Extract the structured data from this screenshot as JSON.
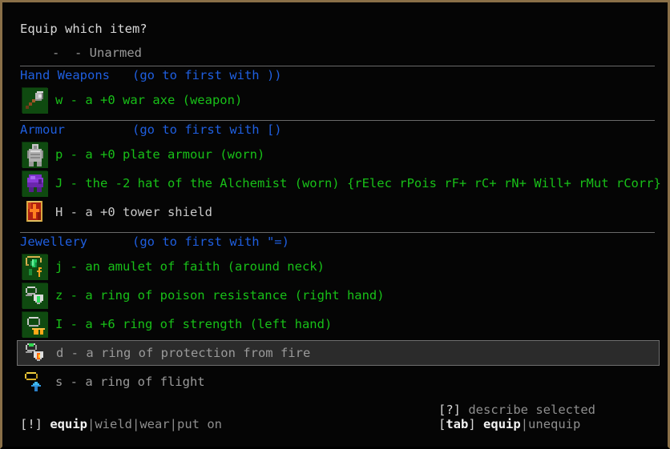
{
  "window": {
    "border_color": "#8a7048",
    "background": "#050505"
  },
  "prompt": {
    "title": "Equip which item?",
    "unarmed_line": "-  - Unarmed"
  },
  "colors": {
    "section_header": "#1f5fe0",
    "item_equipped": "#18c018",
    "item_plain": "#c8c8c8",
    "selected_background": "#2b2b2b",
    "selected_border": "#6f6f6f",
    "separator": "#6a6a6a"
  },
  "sections": [
    {
      "name": "Hand Weapons",
      "hint": "(go to first with ))",
      "items": [
        {
          "letter": "w",
          "text": "w - a +0 war axe (weapon)",
          "icon": "war-axe-icon",
          "tile": "green",
          "color": "green",
          "selected": false
        }
      ]
    },
    {
      "name": "Armour",
      "hint": "(go to first with [)",
      "items": [
        {
          "letter": "p",
          "text": "p - a +0 plate armour (worn)",
          "icon": "plate-armour-icon",
          "tile": "green",
          "color": "green",
          "selected": false
        },
        {
          "letter": "J",
          "text": "J - the -2 hat of the Alchemist (worn) {rElec rPois rF+ rC+ rN+ Will+ rMut rCorr}",
          "icon": "alchemist-hat-icon",
          "tile": "green",
          "color": "green",
          "selected": false
        },
        {
          "letter": "H",
          "text": "H - a +0 tower shield",
          "icon": "tower-shield-icon",
          "tile": "plain",
          "color": "white",
          "selected": false
        }
      ]
    },
    {
      "name": "Jewellery",
      "hint": "(go to first with \"=)",
      "items": [
        {
          "letter": "j",
          "text": "j - an amulet of faith (around neck)",
          "icon": "amulet-of-faith-icon",
          "tile": "green",
          "color": "green",
          "selected": false
        },
        {
          "letter": "z",
          "text": "z - a ring of poison resistance (right hand)",
          "icon": "ring-poison-resistance-icon",
          "tile": "green",
          "color": "green",
          "selected": false
        },
        {
          "letter": "I",
          "text": "I - a +6 ring of strength (left hand)",
          "icon": "ring-of-strength-icon",
          "tile": "green",
          "color": "green",
          "selected": false
        },
        {
          "letter": "d",
          "text": "d - a ring of protection from fire",
          "icon": "ring-protection-fire-icon",
          "tile": "plain",
          "color": "dim",
          "selected": true
        },
        {
          "letter": "s",
          "text": "s - a ring of flight",
          "icon": "ring-of-flight-icon",
          "tile": "plain",
          "color": "dim",
          "selected": false
        }
      ]
    }
  ],
  "footer": {
    "left": {
      "key": "[!]",
      "primary": "equip",
      "alternates": "|wield|wear|put on"
    },
    "right": {
      "describe_key": "[?]",
      "describe_label": "describe selected",
      "tab_key": "[tab]",
      "tab_primary": "equip",
      "tab_alternates": "|unequip"
    }
  }
}
